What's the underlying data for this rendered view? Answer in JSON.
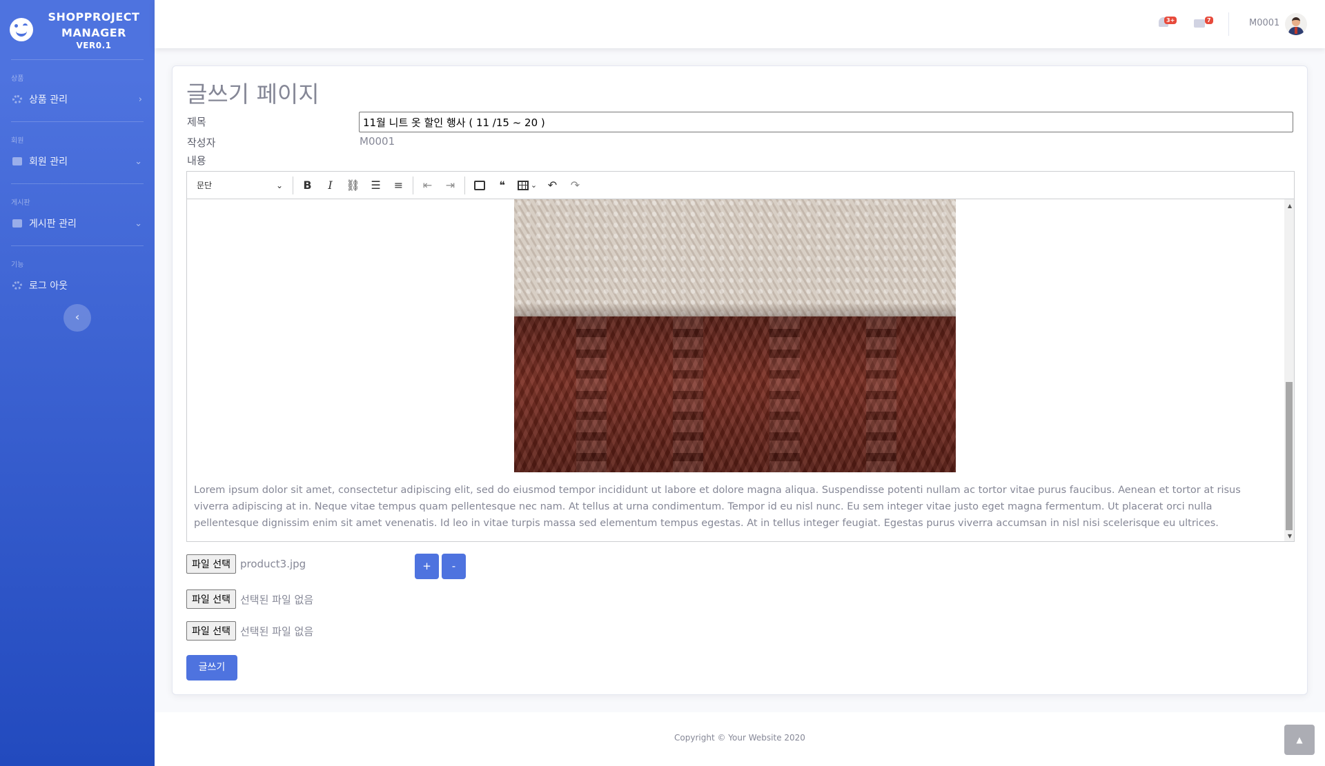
{
  "sidebar": {
    "brand_line1": "SHOPPROJECT",
    "brand_line2": "MANAGER",
    "brand_version": "VER0.1",
    "sections": [
      {
        "heading": "상품",
        "label": "상품 관리",
        "icon": "gear-icon",
        "chevron": "›"
      },
      {
        "heading": "회원",
        "label": "회원 관리",
        "icon": "folder-icon",
        "chevron": "⌄"
      },
      {
        "heading": "게시판",
        "label": "게시판 관리",
        "icon": "folder-icon",
        "chevron": "⌄"
      },
      {
        "heading": "기능",
        "label": "로그 아웃",
        "icon": "gear-icon",
        "chevron": ""
      }
    ],
    "toggle_label": "‹"
  },
  "topbar": {
    "alerts_badge": "3+",
    "messages_badge": "7",
    "user_name": "M0001"
  },
  "page": {
    "title": "글쓰기 페이지",
    "subject_label": "제목",
    "subject_value": "11월 니트 옷 할인 행사 ( 11 /15 ~ 20 )",
    "writer_label": "작성자",
    "writer_value": "M0001",
    "content_label": "내용"
  },
  "editor": {
    "heading_select": "문단",
    "body_text": "Lorem ipsum dolor sit amet, consectetur adipiscing elit, sed do eiusmod tempor incididunt ut labore et dolore magna aliqua. Suspendisse potenti nullam ac tortor vitae purus faucibus. Aenean et tortor at risus viverra adipiscing at in. Neque vitae tempus quam pellentesque nec nam. At tellus at urna condimentum. Tempor id eu nisl nunc. Eu sem integer vitae justo eget magna fermentum. Ut placerat orci nulla pellentesque dignissim enim sit amet venenatis. Id leo in vitae turpis massa sed elementum tempus egestas. At in tellus integer feugiat. Egestas purus viverra accumsan in nisl nisi scelerisque eu ultrices."
  },
  "files": {
    "button_label": "파일 선택",
    "file1": "product3.jpg",
    "file2": "선택된 파일 없음",
    "file3": "선택된 파일 없음",
    "add_label": "+",
    "remove_label": "-"
  },
  "submit_label": "글쓰기",
  "footer": {
    "copyright": "Copyright © Your Website 2020"
  },
  "colors": {
    "primary": "#4e73df",
    "sidebar_dark": "#224abe",
    "badge": "#e74a3b"
  }
}
